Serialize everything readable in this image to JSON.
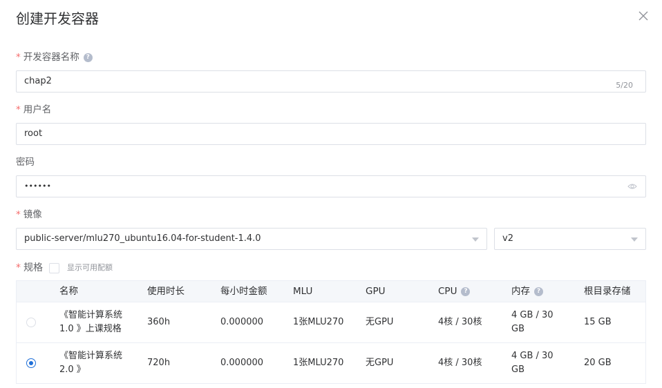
{
  "dialog": {
    "title": "创建开发容器"
  },
  "form": {
    "name": {
      "label": "开发容器名称",
      "required": "*",
      "help": "?",
      "value": "chap2",
      "counter": "5/20"
    },
    "username": {
      "label": "用户名",
      "required": "*",
      "value": "root"
    },
    "password": {
      "label": "密码",
      "value": "••••••"
    },
    "image": {
      "label": "镜像",
      "required": "*",
      "repo": "public-server/mlu270_ubuntu16.04-for-student-1.4.0",
      "tag": "v2"
    },
    "spec": {
      "label": "规格",
      "required": "*",
      "checkbox_label": "显示可用配额",
      "checkbox_checked": false
    }
  },
  "table": {
    "headers": {
      "name": "名称",
      "duration": "使用时长",
      "hourly_cost": "每小时金额",
      "mlu": "MLU",
      "gpu": "GPU",
      "cpu": "CPU",
      "memory": "内存",
      "root_storage": "根目录存储"
    },
    "help": "?",
    "rows": [
      {
        "selected": false,
        "name_line1": "《智能计算系统",
        "name_line2": "1.0 》上课规格",
        "duration": "360h",
        "hourly_cost": "0.000000",
        "mlu": "1张MLU270",
        "gpu": "无GPU",
        "cpu": "4核 / 30核",
        "memory_line1": "4 GB / 30",
        "memory_line2": "GB",
        "root_storage": "15 GB"
      },
      {
        "selected": true,
        "name_line1": "《智能计算系统",
        "name_line2": "2.0 》",
        "duration": "720h",
        "hourly_cost": "0.000000",
        "mlu": "1张MLU270",
        "gpu": "无GPU",
        "cpu": "4核 / 30核",
        "memory_line1": "4 GB / 30",
        "memory_line2": "GB",
        "root_storage": "20 GB"
      }
    ]
  },
  "colors": {
    "required": "#f56c6c",
    "primary": "#1f6fd8",
    "border": "#dcdfe6"
  },
  "icons": {
    "close": "close-icon",
    "help": "question-circle-icon",
    "eye": "eye-icon",
    "caret": "caret-down-icon"
  }
}
